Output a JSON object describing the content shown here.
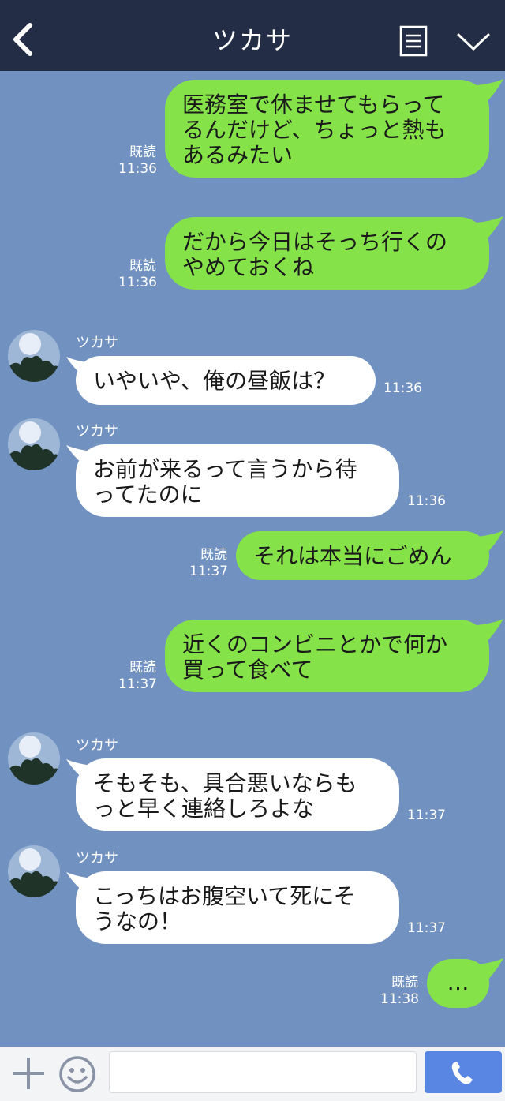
{
  "header": {
    "title": "ツカサ",
    "back_icon": "chevron-left-icon",
    "menu_icon": "menu-list-icon",
    "expand_icon": "chevron-down-icon"
  },
  "colors": {
    "background": "#7191c1",
    "header": "#232d45",
    "my_bubble": "#85e249",
    "their_bubble": "#ffffff",
    "call_button": "#5a86e3"
  },
  "messages": [
    {
      "side": "me",
      "text": "医務室で休ませてもらって\nるんだけど、ちょっと熱も\nあるみたい",
      "read": "既読",
      "time": "11:36"
    },
    {
      "side": "me",
      "text": "だから今日はそっち行くの\nやめておくね",
      "read": "既読",
      "time": "11:36"
    },
    {
      "side": "them",
      "sender": "ツカサ",
      "text": "いやいや、俺の昼飯は？",
      "time": "11:36"
    },
    {
      "side": "them",
      "sender": "ツカサ",
      "text": "お前が来るって言うから待\nってたのに",
      "time": "11:36"
    },
    {
      "side": "me",
      "text": "それは本当にごめん",
      "read": "既読",
      "time": "11:37"
    },
    {
      "side": "me",
      "text": "近くのコンビニとかで何か\n買って食べて",
      "read": "既読",
      "time": "11:37"
    },
    {
      "side": "them",
      "sender": "ツカサ",
      "text": "そもそも、具合悪いならも\nっと早く連絡しろよな",
      "time": "11:37"
    },
    {
      "side": "them",
      "sender": "ツカサ",
      "text": "こっちはお腹空いて死にそ\nうなの！",
      "time": "11:37"
    },
    {
      "side": "me",
      "text": "…",
      "read": "既読",
      "time": "11:38"
    }
  ],
  "input": {
    "placeholder": "",
    "plus_icon": "plus-icon",
    "emoji_icon": "emoji-icon",
    "call_icon": "phone-icon"
  }
}
